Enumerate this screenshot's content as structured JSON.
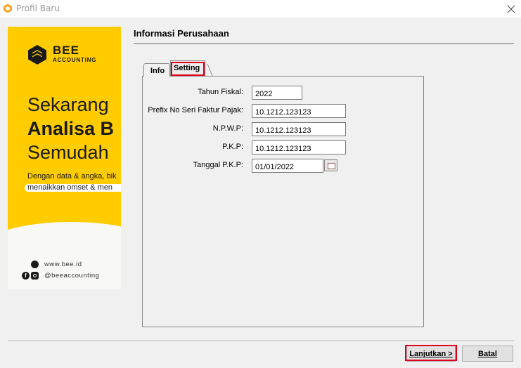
{
  "window": {
    "title": "Profil Baru",
    "close_icon": "close-icon"
  },
  "banner": {
    "brand_name": "BEE",
    "brand_sub": "ACCOUNTING",
    "headline_line1": "Sekarang",
    "headline_line2": "Analisa B",
    "headline_line3": "Semudah",
    "desc_line1": "Dengan data & angka, bik",
    "desc_line2": "menaikkan omset & men",
    "website": "www.bee.id",
    "social": "@beeaccounting",
    "brand_color": "#ffcc00"
  },
  "section": {
    "title": "Informasi Perusahaan"
  },
  "tabs": [
    {
      "label": "Info"
    },
    {
      "label": "Setting"
    }
  ],
  "form": {
    "tahun_fiskal": {
      "label": "Tahun Fiskal:",
      "value": "2022"
    },
    "prefix_faktur": {
      "label": "Prefix No Seri Faktur Pajak:",
      "value": "10.1212.123123"
    },
    "npwp": {
      "label": "N.P.W.P:",
      "value": "10.1212.123123"
    },
    "pkp": {
      "label": "P.K.P:",
      "value": "10.1212.123123"
    },
    "tanggal_pkp": {
      "label": "Tanggal P.K.P:",
      "value": "01/01/2022"
    }
  },
  "buttons": {
    "next": "Lanjutkan >",
    "cancel": "Batal"
  },
  "highlight_color": "#e0001b"
}
